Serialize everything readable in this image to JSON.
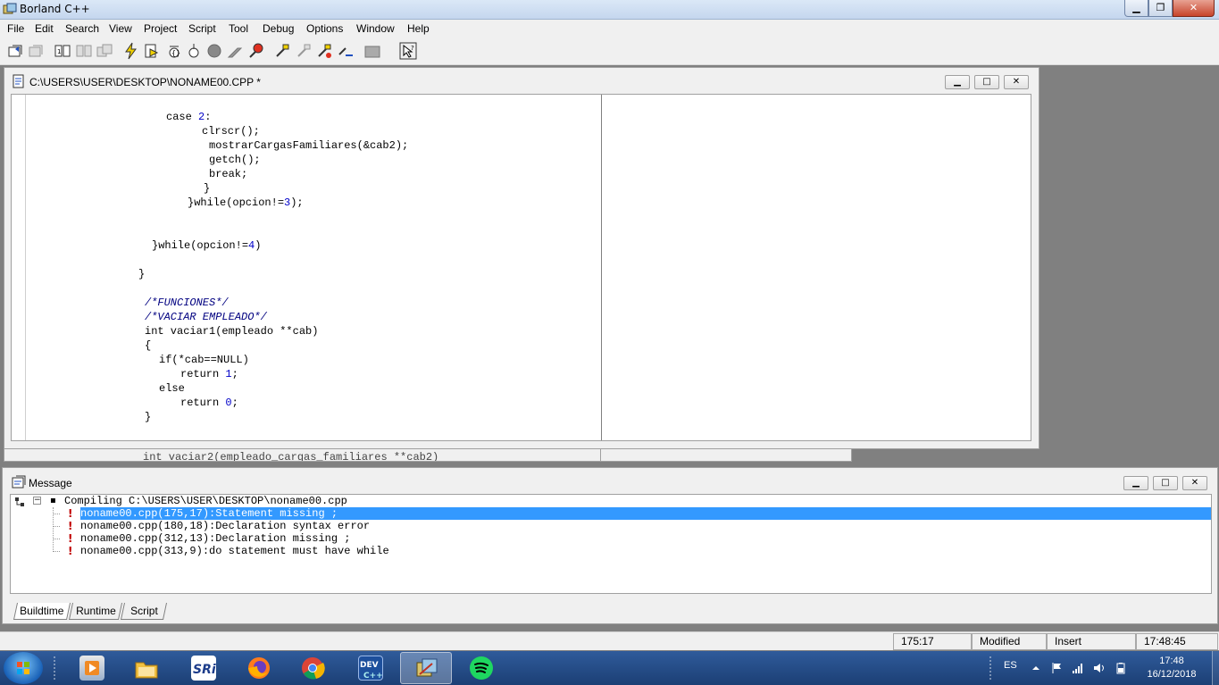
{
  "window": {
    "title": "Borland C++"
  },
  "menu": [
    "File",
    "Edit",
    "Search",
    "View",
    "Project",
    "Script",
    "Tool",
    "Debug",
    "Options",
    "Window",
    "Help"
  ],
  "editor": {
    "title": "C:\\USERS\\USER\\DESKTOP\\NONAME00.CPP *",
    "lines": [
      {
        "text": "case ",
        "num": "2",
        "rest": ":"
      },
      {
        "text": "clrscr();"
      },
      {
        "text": "mostrarCargasFamiliares(&cab2);"
      },
      {
        "text": "getch();"
      },
      {
        "text": "break;"
      },
      {
        "text": "}"
      },
      {
        "text": "}while(opcion!=",
        "num": "3",
        "rest": ");"
      },
      {
        "text": ""
      },
      {
        "text": ""
      },
      {
        "text": "}while(opcion!=",
        "num": "4",
        "rest": ")"
      },
      {
        "text": ""
      },
      {
        "text": "}"
      },
      {
        "text": ""
      },
      {
        "text": "/*FUNCIONES*/",
        "comment": true
      },
      {
        "text": "/*VACIAR EMPLEADO*/",
        "comment": true
      },
      {
        "text": "int vaciar1(empleado **cab)"
      },
      {
        "text": "{"
      },
      {
        "text": "if(*cab==NULL)"
      },
      {
        "text": "return ",
        "num": "1",
        "rest": ";"
      },
      {
        "text": "else"
      },
      {
        "text": "return ",
        "num": "0",
        "rest": ";"
      },
      {
        "text": "}"
      }
    ],
    "partial_line": "int vaciar2(empleado_cargas_familiares **cab2)"
  },
  "messages": {
    "title": "Message",
    "root": "Compiling C:\\USERS\\USER\\DESKTOP\\noname00.cpp",
    "items": [
      "noname00.cpp(175,17):Statement missing ;",
      "noname00.cpp(180,18):Declaration syntax error",
      "noname00.cpp(312,13):Declaration missing ;",
      "noname00.cpp(313,9):do statement must have while"
    ],
    "selected_index": 0,
    "tabs": [
      "Buildtime",
      "Runtime",
      "Script"
    ]
  },
  "status": {
    "position": "175:17",
    "modified": "Modified",
    "mode": "Insert",
    "time": "17:48:45"
  },
  "taskbar": {
    "apps": [
      "media-player",
      "file-explorer",
      "sri",
      "firefox",
      "chrome",
      "dev-cpp",
      "borland-cpp",
      "spotify"
    ],
    "active_app": "borland-cpp",
    "language": "ES",
    "clock_time": "17:48",
    "clock_date": "16/12/2018"
  },
  "colors": {
    "selection": "#3399ff",
    "taskbar": "#1c3f75",
    "error_icon": "#c00000",
    "code_number": "#0000c8",
    "code_comment": "#000080"
  }
}
